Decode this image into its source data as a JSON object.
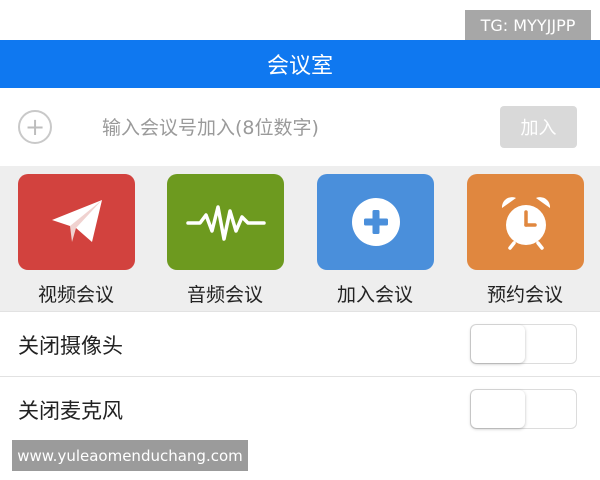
{
  "overlay": {
    "tg_badge": "TG: MYYJJPP",
    "watermark": "www.yuleaomenduchang.com"
  },
  "header": {
    "title": "会议室"
  },
  "join": {
    "placeholder": "输入会议号加入(8位数字)",
    "button_label": "加入",
    "plus_icon": "plus-circle-icon"
  },
  "tiles": [
    {
      "label": "视频会议",
      "icon": "paper-plane-icon",
      "color": "#d2423e"
    },
    {
      "label": "音频会议",
      "icon": "waveform-icon",
      "color": "#6d9a1f"
    },
    {
      "label": "加入会议",
      "icon": "plus-icon",
      "color": "#4a8fdb"
    },
    {
      "label": "预约会议",
      "icon": "alarm-clock-icon",
      "color": "#e0873f"
    }
  ],
  "settings": [
    {
      "label": "关闭摄像头",
      "on": false
    },
    {
      "label": "关闭麦克风",
      "on": false
    }
  ],
  "colors": {
    "header_bg": "#0f78f0",
    "strip_bg": "#eeeeee"
  }
}
